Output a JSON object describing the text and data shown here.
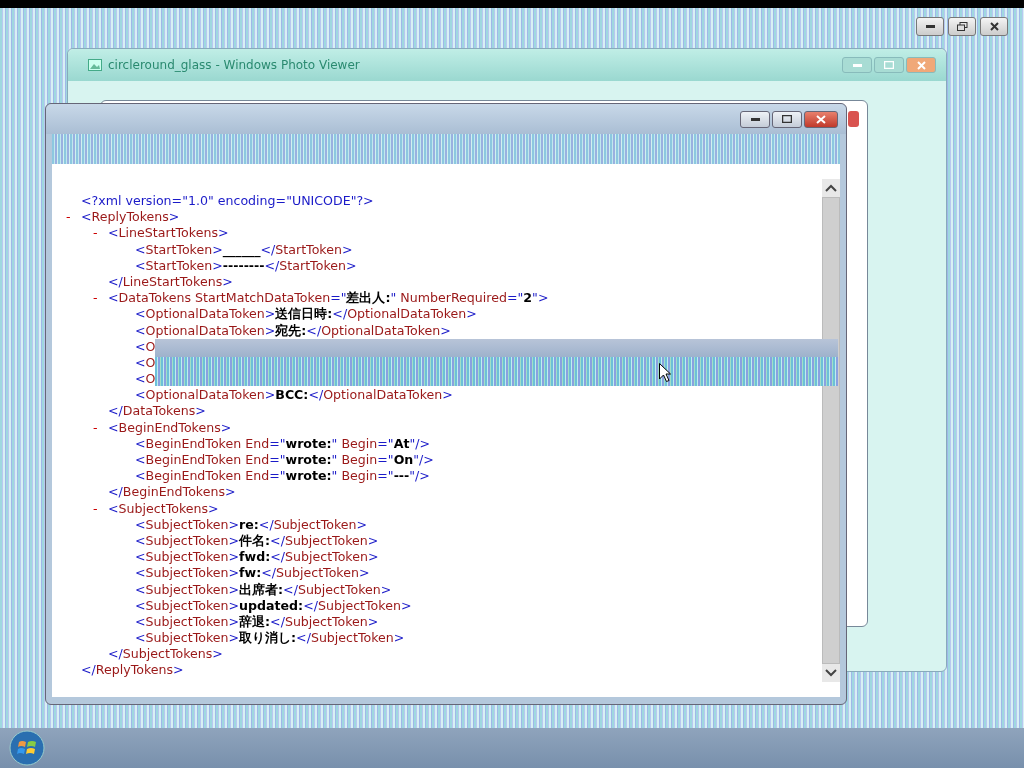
{
  "back_window": {
    "title": "circleround_glass - Windows Photo Viewer"
  },
  "xml": {
    "declaration": [
      {
        "kind": "punct",
        "text": "<?xml version=\"1.0\" encoding=\"UNICODE\"?>"
      }
    ],
    "root": {
      "toggle": "-",
      "open": [
        {
          "kind": "punct",
          "text": "<"
        },
        {
          "kind": "name",
          "text": "ReplyTokens"
        },
        {
          "kind": "punct",
          "text": ">"
        }
      ],
      "children": [
        {
          "toggle": "-",
          "open": [
            {
              "kind": "punct",
              "text": "<"
            },
            {
              "kind": "name",
              "text": "LineStartTokens"
            },
            {
              "kind": "punct",
              "text": ">"
            }
          ],
          "children": [
            {
              "open": [
                {
                  "kind": "punct",
                  "text": "<"
                },
                {
                  "kind": "name",
                  "text": "StartToken"
                },
                {
                  "kind": "punct",
                  "text": ">"
                },
                {
                  "kind": "value",
                  "text": "______"
                },
                {
                  "kind": "punct",
                  "text": "</"
                },
                {
                  "kind": "name",
                  "text": "StartToken"
                },
                {
                  "kind": "punct",
                  "text": ">"
                }
              ]
            },
            {
              "open": [
                {
                  "kind": "punct",
                  "text": "<"
                },
                {
                  "kind": "name",
                  "text": "StartToken"
                },
                {
                  "kind": "punct",
                  "text": ">"
                },
                {
                  "kind": "value",
                  "text": "--------"
                },
                {
                  "kind": "punct",
                  "text": "</"
                },
                {
                  "kind": "name",
                  "text": "StartToken"
                },
                {
                  "kind": "punct",
                  "text": ">"
                }
              ]
            }
          ],
          "close": [
            {
              "kind": "punct",
              "text": "</"
            },
            {
              "kind": "name",
              "text": "LineStartTokens"
            },
            {
              "kind": "punct",
              "text": ">"
            }
          ]
        },
        {
          "toggle": "-",
          "open": [
            {
              "kind": "punct",
              "text": "<"
            },
            {
              "kind": "name",
              "text": "DataTokens StartMatchDataToken"
            },
            {
              "kind": "punct",
              "text": "=\""
            },
            {
              "kind": "value",
              "text": "差出人:"
            },
            {
              "kind": "punct",
              "text": "\""
            },
            {
              "kind": "name",
              "text": " NumberRequired"
            },
            {
              "kind": "punct",
              "text": "=\""
            },
            {
              "kind": "value",
              "text": "2"
            },
            {
              "kind": "punct",
              "text": "\">"
            }
          ],
          "children": [
            {
              "open": [
                {
                  "kind": "punct",
                  "text": "<"
                },
                {
                  "kind": "name",
                  "text": "OptionalDataToken"
                },
                {
                  "kind": "punct",
                  "text": ">"
                },
                {
                  "kind": "value",
                  "text": "送信日時:"
                },
                {
                  "kind": "punct",
                  "text": "</"
                },
                {
                  "kind": "name",
                  "text": "OptionalDataToken"
                },
                {
                  "kind": "punct",
                  "text": ">"
                }
              ]
            },
            {
              "open": [
                {
                  "kind": "punct",
                  "text": "<"
                },
                {
                  "kind": "name",
                  "text": "OptionalDataToken"
                },
                {
                  "kind": "punct",
                  "text": ">"
                },
                {
                  "kind": "value",
                  "text": "宛先:"
                },
                {
                  "kind": "punct",
                  "text": "</"
                },
                {
                  "kind": "name",
                  "text": "OptionalDataToken"
                },
                {
                  "kind": "punct",
                  "text": ">"
                }
              ]
            },
            {
              "open": [
                {
                  "kind": "punct",
                  "text": "<"
                },
                {
                  "kind": "name",
                  "text": "O"
                }
              ]
            },
            {
              "open": [
                {
                  "kind": "punct",
                  "text": "<"
                },
                {
                  "kind": "name",
                  "text": "O"
                }
              ]
            },
            {
              "open": [
                {
                  "kind": "punct",
                  "text": "<"
                },
                {
                  "kind": "name",
                  "text": "O"
                }
              ]
            },
            {
              "open": [
                {
                  "kind": "punct",
                  "text": "<"
                },
                {
                  "kind": "name",
                  "text": "OptionalDataToken"
                },
                {
                  "kind": "punct",
                  "text": ">"
                },
                {
                  "kind": "value",
                  "text": "BCC:"
                },
                {
                  "kind": "punct",
                  "text": "</"
                },
                {
                  "kind": "name",
                  "text": "OptionalDataToken"
                },
                {
                  "kind": "punct",
                  "text": ">"
                }
              ]
            }
          ],
          "close": [
            {
              "kind": "punct",
              "text": "</"
            },
            {
              "kind": "name",
              "text": "DataTokens"
            },
            {
              "kind": "punct",
              "text": ">"
            }
          ]
        },
        {
          "toggle": "-",
          "open": [
            {
              "kind": "punct",
              "text": "<"
            },
            {
              "kind": "name",
              "text": "BeginEndTokens"
            },
            {
              "kind": "punct",
              "text": ">"
            }
          ],
          "children": [
            {
              "open": [
                {
                  "kind": "punct",
                  "text": "<"
                },
                {
                  "kind": "name",
                  "text": "BeginEndToken End"
                },
                {
                  "kind": "punct",
                  "text": "=\""
                },
                {
                  "kind": "value",
                  "text": "wrote:"
                },
                {
                  "kind": "punct",
                  "text": "\""
                },
                {
                  "kind": "name",
                  "text": " Begin"
                },
                {
                  "kind": "punct",
                  "text": "=\""
                },
                {
                  "kind": "value",
                  "text": "At"
                },
                {
                  "kind": "punct",
                  "text": "\"/>"
                }
              ]
            },
            {
              "open": [
                {
                  "kind": "punct",
                  "text": "<"
                },
                {
                  "kind": "name",
                  "text": "BeginEndToken End"
                },
                {
                  "kind": "punct",
                  "text": "=\""
                },
                {
                  "kind": "value",
                  "text": "wrote:"
                },
                {
                  "kind": "punct",
                  "text": "\""
                },
                {
                  "kind": "name",
                  "text": " Begin"
                },
                {
                  "kind": "punct",
                  "text": "=\""
                },
                {
                  "kind": "value",
                  "text": "On"
                },
                {
                  "kind": "punct",
                  "text": "\"/>"
                }
              ]
            },
            {
              "open": [
                {
                  "kind": "punct",
                  "text": "<"
                },
                {
                  "kind": "name",
                  "text": "BeginEndToken End"
                },
                {
                  "kind": "punct",
                  "text": "=\""
                },
                {
                  "kind": "value",
                  "text": "wrote:"
                },
                {
                  "kind": "punct",
                  "text": "\""
                },
                {
                  "kind": "name",
                  "text": " Begin"
                },
                {
                  "kind": "punct",
                  "text": "=\""
                },
                {
                  "kind": "value",
                  "text": "---"
                },
                {
                  "kind": "punct",
                  "text": "\"/>"
                }
              ]
            }
          ],
          "close": [
            {
              "kind": "punct",
              "text": "</"
            },
            {
              "kind": "name",
              "text": "BeginEndTokens"
            },
            {
              "kind": "punct",
              "text": ">"
            }
          ]
        },
        {
          "toggle": "-",
          "open": [
            {
              "kind": "punct",
              "text": "<"
            },
            {
              "kind": "name",
              "text": "SubjectTokens"
            },
            {
              "kind": "punct",
              "text": ">"
            }
          ],
          "children": [
            {
              "open": [
                {
                  "kind": "punct",
                  "text": "<"
                },
                {
                  "kind": "name",
                  "text": "SubjectToken"
                },
                {
                  "kind": "punct",
                  "text": ">"
                },
                {
                  "kind": "value",
                  "text": "re:"
                },
                {
                  "kind": "punct",
                  "text": "</"
                },
                {
                  "kind": "name",
                  "text": "SubjectToken"
                },
                {
                  "kind": "punct",
                  "text": ">"
                }
              ]
            },
            {
              "open": [
                {
                  "kind": "punct",
                  "text": "<"
                },
                {
                  "kind": "name",
                  "text": "SubjectToken"
                },
                {
                  "kind": "punct",
                  "text": ">"
                },
                {
                  "kind": "value",
                  "text": "件名:"
                },
                {
                  "kind": "punct",
                  "text": "</"
                },
                {
                  "kind": "name",
                  "text": "SubjectToken"
                },
                {
                  "kind": "punct",
                  "text": ">"
                }
              ]
            },
            {
              "open": [
                {
                  "kind": "punct",
                  "text": "<"
                },
                {
                  "kind": "name",
                  "text": "SubjectToken"
                },
                {
                  "kind": "punct",
                  "text": ">"
                },
                {
                  "kind": "value",
                  "text": "fwd:"
                },
                {
                  "kind": "punct",
                  "text": "</"
                },
                {
                  "kind": "name",
                  "text": "SubjectToken"
                },
                {
                  "kind": "punct",
                  "text": ">"
                }
              ]
            },
            {
              "open": [
                {
                  "kind": "punct",
                  "text": "<"
                },
                {
                  "kind": "name",
                  "text": "SubjectToken"
                },
                {
                  "kind": "punct",
                  "text": ">"
                },
                {
                  "kind": "value",
                  "text": "fw:"
                },
                {
                  "kind": "punct",
                  "text": "</"
                },
                {
                  "kind": "name",
                  "text": "SubjectToken"
                },
                {
                  "kind": "punct",
                  "text": ">"
                }
              ]
            },
            {
              "open": [
                {
                  "kind": "punct",
                  "text": "<"
                },
                {
                  "kind": "name",
                  "text": "SubjectToken"
                },
                {
                  "kind": "punct",
                  "text": ">"
                },
                {
                  "kind": "value",
                  "text": "出席者:"
                },
                {
                  "kind": "punct",
                  "text": "</"
                },
                {
                  "kind": "name",
                  "text": "SubjectToken"
                },
                {
                  "kind": "punct",
                  "text": ">"
                }
              ]
            },
            {
              "open": [
                {
                  "kind": "punct",
                  "text": "<"
                },
                {
                  "kind": "name",
                  "text": "SubjectToken"
                },
                {
                  "kind": "punct",
                  "text": ">"
                },
                {
                  "kind": "value",
                  "text": "updated:"
                },
                {
                  "kind": "punct",
                  "text": "</"
                },
                {
                  "kind": "name",
                  "text": "SubjectToken"
                },
                {
                  "kind": "punct",
                  "text": ">"
                }
              ]
            },
            {
              "open": [
                {
                  "kind": "punct",
                  "text": "<"
                },
                {
                  "kind": "name",
                  "text": "SubjectToken"
                },
                {
                  "kind": "punct",
                  "text": ">"
                },
                {
                  "kind": "value",
                  "text": "辞退:"
                },
                {
                  "kind": "punct",
                  "text": "</"
                },
                {
                  "kind": "name",
                  "text": "SubjectToken"
                },
                {
                  "kind": "punct",
                  "text": ">"
                }
              ]
            },
            {
              "open": [
                {
                  "kind": "punct",
                  "text": "<"
                },
                {
                  "kind": "name",
                  "text": "SubjectToken"
                },
                {
                  "kind": "punct",
                  "text": ">"
                },
                {
                  "kind": "value",
                  "text": "取り消し:"
                },
                {
                  "kind": "punct",
                  "text": "</"
                },
                {
                  "kind": "name",
                  "text": "SubjectToken"
                },
                {
                  "kind": "punct",
                  "text": ">"
                }
              ]
            }
          ],
          "close": [
            {
              "kind": "punct",
              "text": "</"
            },
            {
              "kind": "name",
              "text": "SubjectTokens"
            },
            {
              "kind": "punct",
              "text": ">"
            }
          ]
        }
      ],
      "close": [
        {
          "kind": "punct",
          "text": "</"
        },
        {
          "kind": "name",
          "text": "ReplyTokens"
        },
        {
          "kind": "punct",
          "text": ">"
        }
      ]
    }
  }
}
